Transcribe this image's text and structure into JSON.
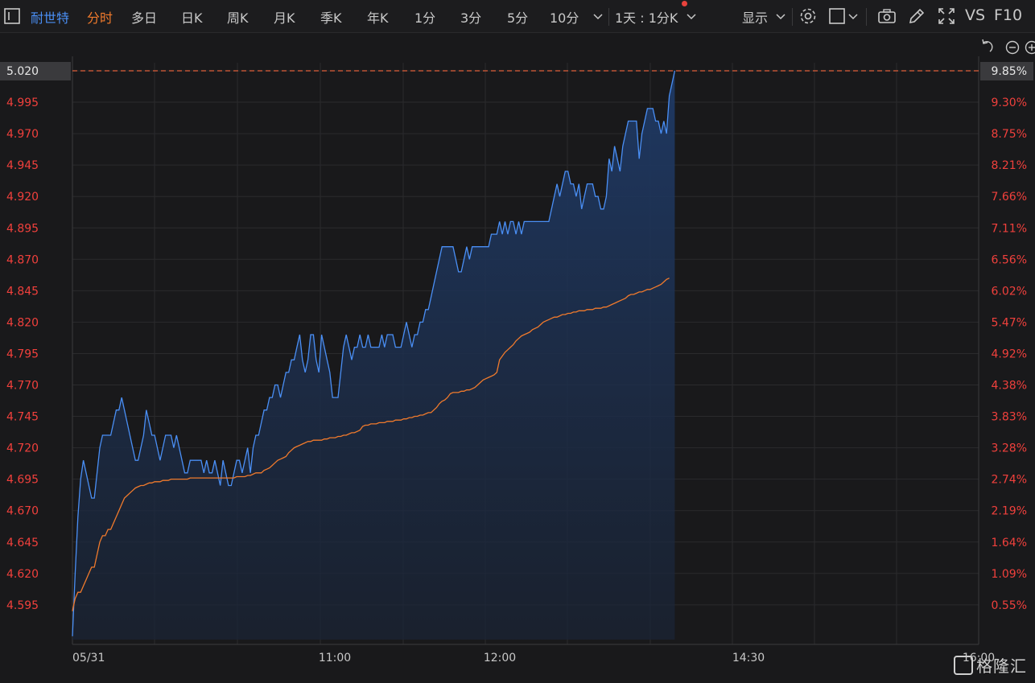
{
  "toolbar": {
    "stock_name": "耐世特",
    "tabs": [
      "分时",
      "多日",
      "日K",
      "周K",
      "月K",
      "季K",
      "年K",
      "1分",
      "3分",
      "5分",
      "10分"
    ],
    "period_select": "1天 : 1分K",
    "display_label": "显示",
    "vs_label": "VS",
    "f10_label": "F10"
  },
  "watermark": "格隆汇",
  "chart_data": {
    "type": "line",
    "date_label": "05/31",
    "x_ticks": [
      "05/31",
      "11:00",
      "12:00",
      "14:30",
      "16:00"
    ],
    "y_left_ticks": [
      "5.020",
      "4.995",
      "4.970",
      "4.945",
      "4.920",
      "4.895",
      "4.870",
      "4.845",
      "4.820",
      "4.795",
      "4.770",
      "4.745",
      "4.720",
      "4.695",
      "4.670",
      "4.645",
      "4.620",
      "4.595"
    ],
    "y_right_ticks": [
      "9.85%",
      "9.30%",
      "8.75%",
      "8.21%",
      "7.66%",
      "7.11%",
      "6.56%",
      "6.02%",
      "5.47%",
      "4.92%",
      "4.38%",
      "3.83%",
      "3.28%",
      "2.74%",
      "2.19%",
      "1.64%",
      "1.09%",
      "0.55%"
    ],
    "ylim": [
      4.57,
      5.02
    ],
    "current_price": "5.020",
    "current_pct": "9.85%",
    "series": [
      {
        "values": [
          4.57,
          4.62,
          4.665,
          4.695,
          4.71,
          4.7,
          4.69,
          4.68,
          4.68,
          4.7,
          4.72,
          4.73,
          4.73,
          4.73,
          4.73,
          4.74,
          4.75,
          4.75,
          4.76,
          4.75,
          4.74,
          4.73,
          4.72,
          4.71,
          4.71,
          4.72,
          4.73,
          4.75,
          4.74,
          4.73,
          4.73,
          4.72,
          4.71,
          4.72,
          4.73,
          4.73,
          4.73,
          4.72,
          4.73,
          4.72,
          4.71,
          4.7,
          4.7,
          4.71,
          4.71,
          4.71,
          4.71,
          4.71,
          4.7,
          4.71,
          4.7,
          4.7,
          4.71,
          4.7,
          4.69,
          4.71,
          4.7,
          4.69,
          4.69,
          4.7,
          4.71,
          4.71,
          4.7,
          4.71,
          4.72,
          4.7,
          4.72,
          4.73,
          4.73,
          4.74,
          4.75,
          4.75,
          4.76,
          4.76,
          4.77,
          4.77,
          4.76,
          4.77,
          4.78,
          4.78,
          4.79,
          4.79,
          4.8,
          4.81,
          4.79,
          4.78,
          4.79,
          4.81,
          4.81,
          4.79,
          4.78,
          4.81,
          4.8,
          4.79,
          4.78,
          4.76,
          4.76,
          4.76,
          4.78,
          4.8,
          4.81,
          4.8,
          4.79,
          4.8,
          4.8,
          4.81,
          4.8,
          4.8,
          4.81,
          4.8,
          4.8,
          4.8,
          4.8,
          4.81,
          4.8,
          4.81,
          4.81,
          4.81,
          4.8,
          4.8,
          4.8,
          4.81,
          4.82,
          4.81,
          4.8,
          4.81,
          4.81,
          4.82,
          4.82,
          4.83,
          4.83,
          4.84,
          4.85,
          4.86,
          4.87,
          4.88,
          4.88,
          4.88,
          4.88,
          4.88,
          4.87,
          4.86,
          4.86,
          4.87,
          4.88,
          4.87,
          4.88,
          4.88,
          4.88,
          4.88,
          4.88,
          4.88,
          4.88,
          4.89,
          4.89,
          4.89,
          4.9,
          4.89,
          4.9,
          4.89,
          4.9,
          4.9,
          4.89,
          4.9,
          4.89,
          4.9,
          4.9,
          4.9,
          4.9,
          4.9,
          4.9,
          4.9,
          4.9,
          4.9,
          4.9,
          4.91,
          4.92,
          4.93,
          4.92,
          4.93,
          4.94,
          4.94,
          4.93,
          4.93,
          4.92,
          4.93,
          4.91,
          4.92,
          4.93,
          4.93,
          4.93,
          4.92,
          4.92,
          4.91,
          4.91,
          4.92,
          4.95,
          4.94,
          4.96,
          4.95,
          4.94,
          4.96,
          4.97,
          4.98,
          4.98,
          4.98,
          4.98,
          4.95,
          4.97,
          4.98,
          4.99,
          4.99,
          4.99,
          4.98,
          4.98,
          4.97,
          4.98,
          4.97,
          5.0,
          5.01,
          5.02
        ]
      },
      {
        "values": [
          4.59,
          4.6,
          4.605,
          4.605,
          4.61,
          4.615,
          4.62,
          4.625,
          4.625,
          4.635,
          4.645,
          4.65,
          4.65,
          4.655,
          4.655,
          4.66,
          4.665,
          4.67,
          4.675,
          4.68,
          4.682,
          4.684,
          4.686,
          4.688,
          4.689,
          4.69,
          4.69,
          4.691,
          4.692,
          4.692,
          4.693,
          4.693,
          4.693,
          4.694,
          4.694,
          4.694,
          4.695,
          4.695,
          4.695,
          4.695,
          4.695,
          4.695,
          4.695,
          4.696,
          4.696,
          4.696,
          4.696,
          4.696,
          4.696,
          4.696,
          4.696,
          4.696,
          4.696,
          4.696,
          4.696,
          4.696,
          4.696,
          4.696,
          4.696,
          4.696,
          4.697,
          4.697,
          4.697,
          4.697,
          4.698,
          4.698,
          4.699,
          4.7,
          4.7,
          4.7,
          4.702,
          4.703,
          4.704,
          4.706,
          4.708,
          4.71,
          4.711,
          4.712,
          4.713,
          4.716,
          4.718,
          4.72,
          4.721,
          4.722,
          4.723,
          4.724,
          4.725,
          4.725,
          4.726,
          4.726,
          4.726,
          4.726,
          4.727,
          4.727,
          4.728,
          4.728,
          4.728,
          4.729,
          4.729,
          4.73,
          4.73,
          4.731,
          4.732,
          4.732,
          4.733,
          4.734,
          4.737,
          4.738,
          4.738,
          4.739,
          4.739,
          4.739,
          4.74,
          4.74,
          4.74,
          4.741,
          4.741,
          4.741,
          4.742,
          4.742,
          4.742,
          4.743,
          4.743,
          4.744,
          4.744,
          4.745,
          4.745,
          4.746,
          4.746,
          4.747,
          4.748,
          4.748,
          4.75,
          4.752,
          4.755,
          4.757,
          4.758,
          4.76,
          4.763,
          4.764,
          4.764,
          4.764,
          4.765,
          4.765,
          4.766,
          4.766,
          4.767,
          4.768,
          4.77,
          4.772,
          4.774,
          4.775,
          4.776,
          4.777,
          4.778,
          4.78,
          4.79,
          4.793,
          4.796,
          4.798,
          4.8,
          4.802,
          4.805,
          4.807,
          4.809,
          4.81,
          4.811,
          4.812,
          4.814,
          4.815,
          4.816,
          4.818,
          4.82,
          4.821,
          4.822,
          4.823,
          4.824,
          4.824,
          4.825,
          4.826,
          4.826,
          4.827,
          4.827,
          4.828,
          4.828,
          4.829,
          4.829,
          4.829,
          4.83,
          4.83,
          4.83,
          4.831,
          4.831,
          4.831,
          4.832,
          4.832,
          4.833,
          4.834,
          4.835,
          4.836,
          4.837,
          4.838,
          4.839,
          4.841,
          4.842,
          4.842,
          4.843,
          4.844,
          4.844,
          4.845,
          4.846,
          4.846,
          4.847,
          4.848,
          4.849,
          4.85,
          4.852,
          4.854,
          4.855
        ]
      }
    ]
  },
  "colors": {
    "price_line": "#4a8ff5",
    "avg_line": "#f07a2c",
    "axis_text": "#f0403c",
    "grid": "#2a2a2d",
    "current_line": "#e0603a"
  }
}
